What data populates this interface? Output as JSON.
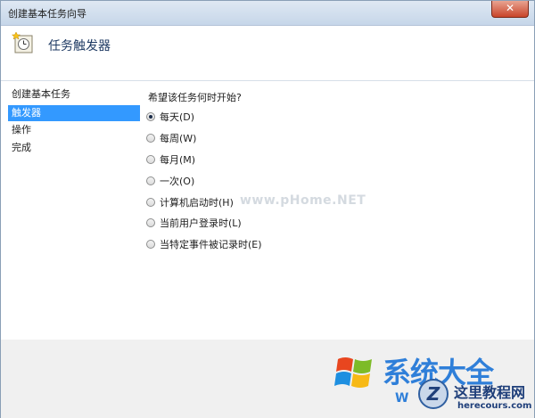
{
  "window": {
    "title": "创建基本任务向导",
    "close_label": "✕"
  },
  "header": {
    "title": "任务触发器"
  },
  "sidebar": {
    "items": [
      {
        "label": "创建基本任务",
        "active": false
      },
      {
        "label": "触发器",
        "active": true
      },
      {
        "label": "操作",
        "active": false
      },
      {
        "label": "完成",
        "active": false
      }
    ]
  },
  "content": {
    "question": "希望该任务何时开始?",
    "options": [
      {
        "label": "每天(D)",
        "checked": true
      },
      {
        "label": "每周(W)",
        "checked": false
      },
      {
        "label": "每月(M)",
        "checked": false
      },
      {
        "label": "一次(O)",
        "checked": false
      },
      {
        "label": "计算机启动时(H)",
        "checked": false
      },
      {
        "label": "当前用户登录时(L)",
        "checked": false
      },
      {
        "label": "当特定事件被记录时(E)",
        "checked": false
      }
    ]
  },
  "watermark": "www.pHome.NET",
  "branding": {
    "site1": "系统大全",
    "site1_sub": "W",
    "site2_logo": "Z",
    "site2_name": "这里教程网",
    "site2_url": "herecours.com"
  },
  "colors": {
    "selection": "#3399ff",
    "heading": "#1e3a63",
    "close": "#c8442a"
  }
}
